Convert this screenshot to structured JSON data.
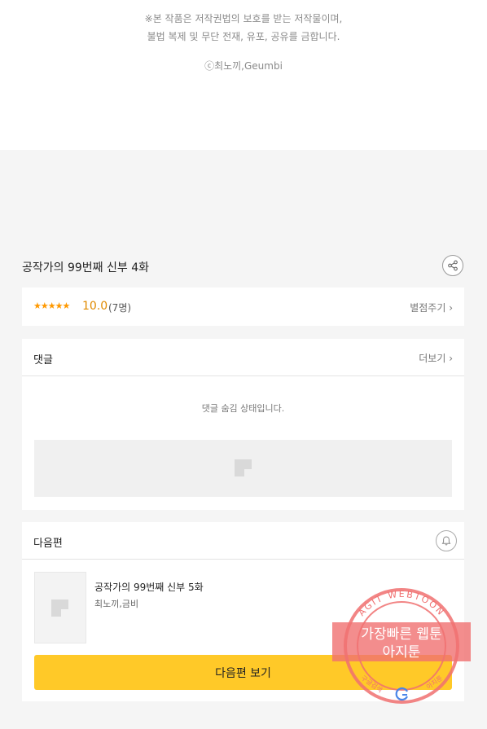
{
  "notice": {
    "line1": "※본 작품은 저작권법의 보호를 받는 저작물이며,",
    "line2": "불법 복제 및 무단 전재, 유포, 공유를 금합니다.",
    "copyright": "ⓒ최노끼,Geumbi"
  },
  "episode": {
    "title": "공작가의 99번째 신부 4화"
  },
  "rating": {
    "stars": "★★★★★",
    "score": "10.0",
    "count": "(7명)",
    "rate_link": "별점주기 ›"
  },
  "comments": {
    "header": "댓글",
    "more_link": "더보기 ›",
    "hidden_message": "댓글 숨김 상태입니다."
  },
  "next_episode": {
    "header": "다음편",
    "title": "공작가의 99번째 신부 5화",
    "author": "최노끼,금비",
    "button_label": "다음편 보기"
  },
  "watermark": {
    "arc_text": "AGIT WEBTOON",
    "line1": "가장빠른 웹툰",
    "line2": "아지툰",
    "bottom_left": "구글검색",
    "bottom_right": "아지툰"
  },
  "colors": {
    "accent_yellow": "#ffc928",
    "star_orange": "#ff9900",
    "stamp_red": "#f07070"
  }
}
